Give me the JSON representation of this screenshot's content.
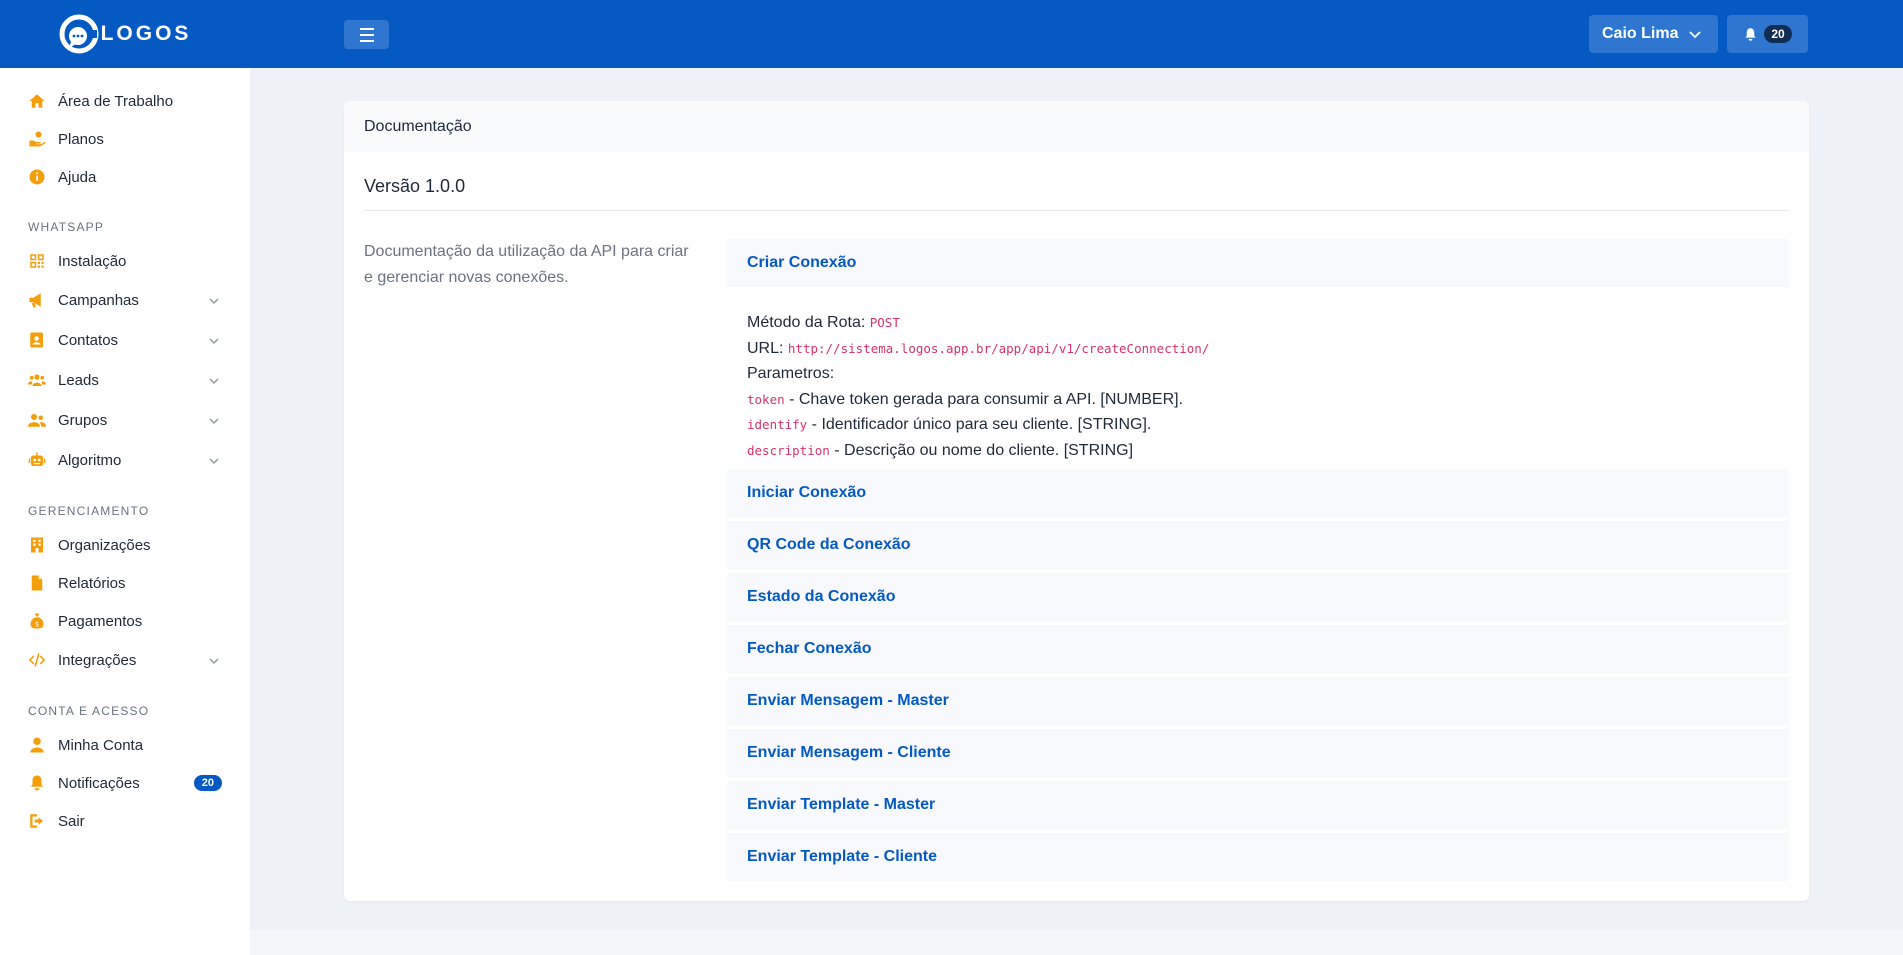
{
  "brand": {
    "name": "LOGOS"
  },
  "sidebar": {
    "top_items": [
      {
        "label": "Área de Trabalho",
        "icon": "home-icon"
      },
      {
        "label": "Planos",
        "icon": "hand-coin-icon"
      },
      {
        "label": "Ajuda",
        "icon": "info-icon"
      }
    ],
    "sections": [
      {
        "title": "WHATSAPP",
        "items": [
          {
            "label": "Instalação",
            "icon": "qrcode-icon"
          },
          {
            "label": "Campanhas",
            "icon": "megaphone-icon",
            "expandable": true
          },
          {
            "label": "Contatos",
            "icon": "address-book-icon",
            "expandable": true
          },
          {
            "label": "Leads",
            "icon": "users-icon",
            "expandable": true
          },
          {
            "label": "Grupos",
            "icon": "user-group-icon",
            "expandable": true
          },
          {
            "label": "Algoritmo",
            "icon": "robot-icon",
            "expandable": true
          }
        ]
      },
      {
        "title": "GERENCIAMENTO",
        "items": [
          {
            "label": "Organizações",
            "icon": "building-icon"
          },
          {
            "label": "Relatórios",
            "icon": "file-icon"
          },
          {
            "label": "Pagamentos",
            "icon": "money-bag-icon"
          },
          {
            "label": "Integrações",
            "icon": "code-icon",
            "expandable": true
          }
        ]
      },
      {
        "title": "CONTA E ACESSO",
        "items": [
          {
            "label": "Minha Conta",
            "icon": "user-icon"
          },
          {
            "label": "Notificações",
            "icon": "bell-icon",
            "badge": "20"
          },
          {
            "label": "Sair",
            "icon": "sign-out-icon"
          }
        ]
      }
    ]
  },
  "topbar": {
    "user_name": "Caio Lima",
    "notification_count": "20"
  },
  "card": {
    "header": "Documentação",
    "version": "Versão 1.0.0",
    "description": "Documentação da utilização da API para criar e gerenciar novas conexões.",
    "expanded": {
      "title": "Criar Conexão",
      "method_label": "Método da Rota:",
      "method": "POST",
      "url_label": "URL:",
      "url": "http://sistema.logos.app.br/app/api/v1/createConnection/",
      "params_label": "Parametros:",
      "params": [
        {
          "name": "token",
          "desc": " - Chave token gerada para consumir a API. [NUMBER]."
        },
        {
          "name": "identify",
          "desc": " - Identificador único para seu cliente. [STRING]."
        },
        {
          "name": "description",
          "desc": " - Descrição ou nome do cliente. [STRING]"
        }
      ]
    },
    "sections": [
      "Iniciar Conexão",
      "QR Code da Conexão",
      "Estado da Conexão",
      "Fechar Conexão",
      "Enviar Mensagem - Master",
      "Enviar Mensagem - Cliente",
      "Enviar Template - Master",
      "Enviar Template - Cliente"
    ]
  },
  "colors": {
    "primary": "#0559c2",
    "icon": "#f59e0b",
    "code": "#d6336c"
  }
}
